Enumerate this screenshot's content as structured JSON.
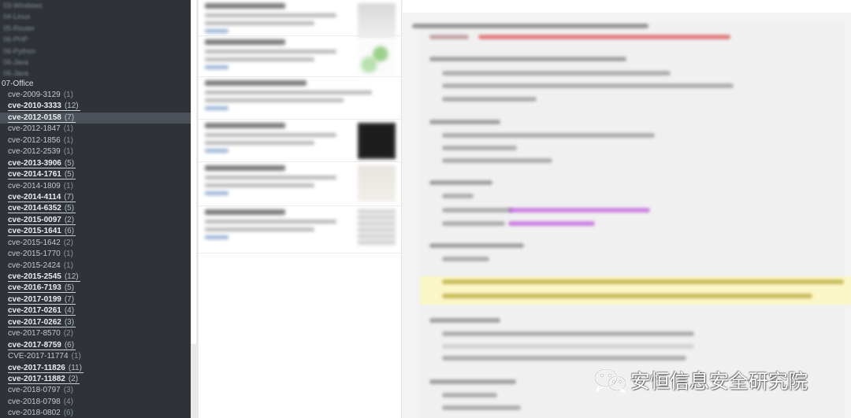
{
  "sidebar": {
    "blurred_items": [
      "03-Windows",
      "04-Linux",
      "05-Router",
      "06-PHP",
      "06-Python",
      "06-Java",
      "06-Java"
    ],
    "group_label": "07-Office",
    "items": [
      {
        "label": "cve-2009-3129",
        "count": "(1)",
        "bold": false,
        "selected": false
      },
      {
        "label": "cve-2010-3333",
        "count": "(12)",
        "bold": true,
        "selected": false
      },
      {
        "label": "cve-2012-0158",
        "count": "(7)",
        "bold": true,
        "selected": true
      },
      {
        "label": "cve-2012-1847",
        "count": "(1)",
        "bold": false,
        "selected": false
      },
      {
        "label": "cve-2012-1856",
        "count": "(1)",
        "bold": false,
        "selected": false
      },
      {
        "label": "cve-2012-2539",
        "count": "(1)",
        "bold": false,
        "selected": false
      },
      {
        "label": "cve-2013-3906",
        "count": "(5)",
        "bold": true,
        "selected": false
      },
      {
        "label": "cve-2014-1761",
        "count": "(5)",
        "bold": true,
        "selected": false
      },
      {
        "label": "cve-2014-1809",
        "count": "(1)",
        "bold": false,
        "selected": false
      },
      {
        "label": "cve-2014-4114",
        "count": "(7)",
        "bold": true,
        "selected": false
      },
      {
        "label": "cve-2014-6352",
        "count": "(5)",
        "bold": true,
        "selected": false
      },
      {
        "label": "cve-2015-0097",
        "count": "(2)",
        "bold": true,
        "selected": false
      },
      {
        "label": "cve-2015-1641",
        "count": "(6)",
        "bold": true,
        "selected": false
      },
      {
        "label": "cve-2015-1642",
        "count": "(2)",
        "bold": false,
        "selected": false
      },
      {
        "label": "cve-2015-1770",
        "count": "(1)",
        "bold": false,
        "selected": false
      },
      {
        "label": "cve-2015-2424",
        "count": "(1)",
        "bold": false,
        "selected": false
      },
      {
        "label": "cve-2015-2545",
        "count": "(12)",
        "bold": true,
        "selected": false
      },
      {
        "label": "cve-2016-7193",
        "count": "(5)",
        "bold": true,
        "selected": false
      },
      {
        "label": "cve-2017-0199",
        "count": "(7)",
        "bold": true,
        "selected": false
      },
      {
        "label": "cve-2017-0261",
        "count": "(4)",
        "bold": true,
        "selected": false
      },
      {
        "label": "cve-2017-0262",
        "count": "(3)",
        "bold": true,
        "selected": false
      },
      {
        "label": "cve-2017-8570",
        "count": "(2)",
        "bold": false,
        "selected": false
      },
      {
        "label": "cve-2017-8759",
        "count": "(6)",
        "bold": true,
        "selected": false
      },
      {
        "label": "CVE-2017-11774",
        "count": "(1)",
        "bold": false,
        "selected": false
      },
      {
        "label": "cve-2017-11826",
        "count": "(11)",
        "bold": true,
        "selected": false
      },
      {
        "label": "cve-2017-11882",
        "count": "(2)",
        "bold": true,
        "selected": false
      },
      {
        "label": "cve-2018-0797",
        "count": "(3)",
        "bold": false,
        "selected": false
      },
      {
        "label": "cve-2018-0798",
        "count": "(4)",
        "bold": false,
        "selected": false
      },
      {
        "label": "cve-2018-0802",
        "count": "(6)",
        "bold": false,
        "selected": false
      }
    ]
  },
  "notes": [
    {
      "thumb": "light-gray"
    },
    {
      "thumb": "green-sketch"
    },
    {
      "thumb": "none"
    },
    {
      "thumb": "dark-terminal"
    },
    {
      "thumb": "light-doc"
    },
    {
      "thumb": "gray-doc"
    }
  ],
  "watermark": {
    "icon": "wechat-icon",
    "text": "安恒信息安全研究院"
  },
  "colors": {
    "sidebar_bg": "#2f3338",
    "selected_bg": "#4b5259",
    "highlight": "#fbf6c6",
    "code_red": "#e05a5a",
    "code_link": "#c060e0"
  }
}
